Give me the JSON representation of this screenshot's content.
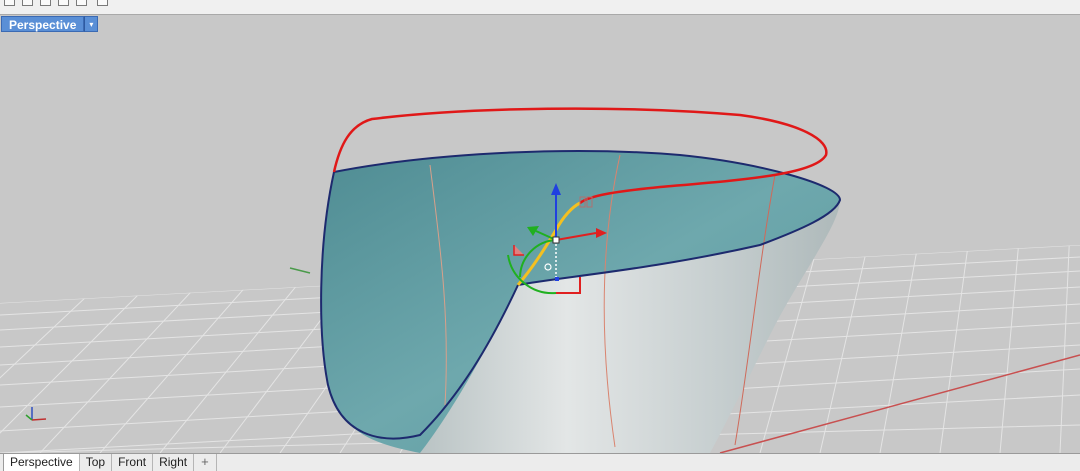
{
  "viewport": {
    "title": "Perspective",
    "menu_glyph": "▾"
  },
  "tabs": [
    {
      "label": "Perspective",
      "active": true
    },
    {
      "label": "Top",
      "active": false
    },
    {
      "label": "Front",
      "active": false
    },
    {
      "label": "Right",
      "active": false
    }
  ],
  "add_tab_glyph": "+",
  "colors": {
    "background": "#c8c8c8",
    "grid_line": "#e6e6e6",
    "surface_inner": "#5d9aa0",
    "surface_outer": "#c9d0d0",
    "edge_blue": "#1d2a6e",
    "curve_red": "#e01818",
    "highlight_yellow": "#f4c020",
    "gumball_x": "#e02020",
    "gumball_y": "#20b020",
    "gumball_z": "#2040e0",
    "title_active": "#5a8fd6"
  },
  "icons": {
    "add_tab": "plus-icon",
    "viewport_menu": "chevron-down-icon",
    "axis_widget": "world-axes-icon",
    "gumball": "gumball-manipulator-icon"
  }
}
